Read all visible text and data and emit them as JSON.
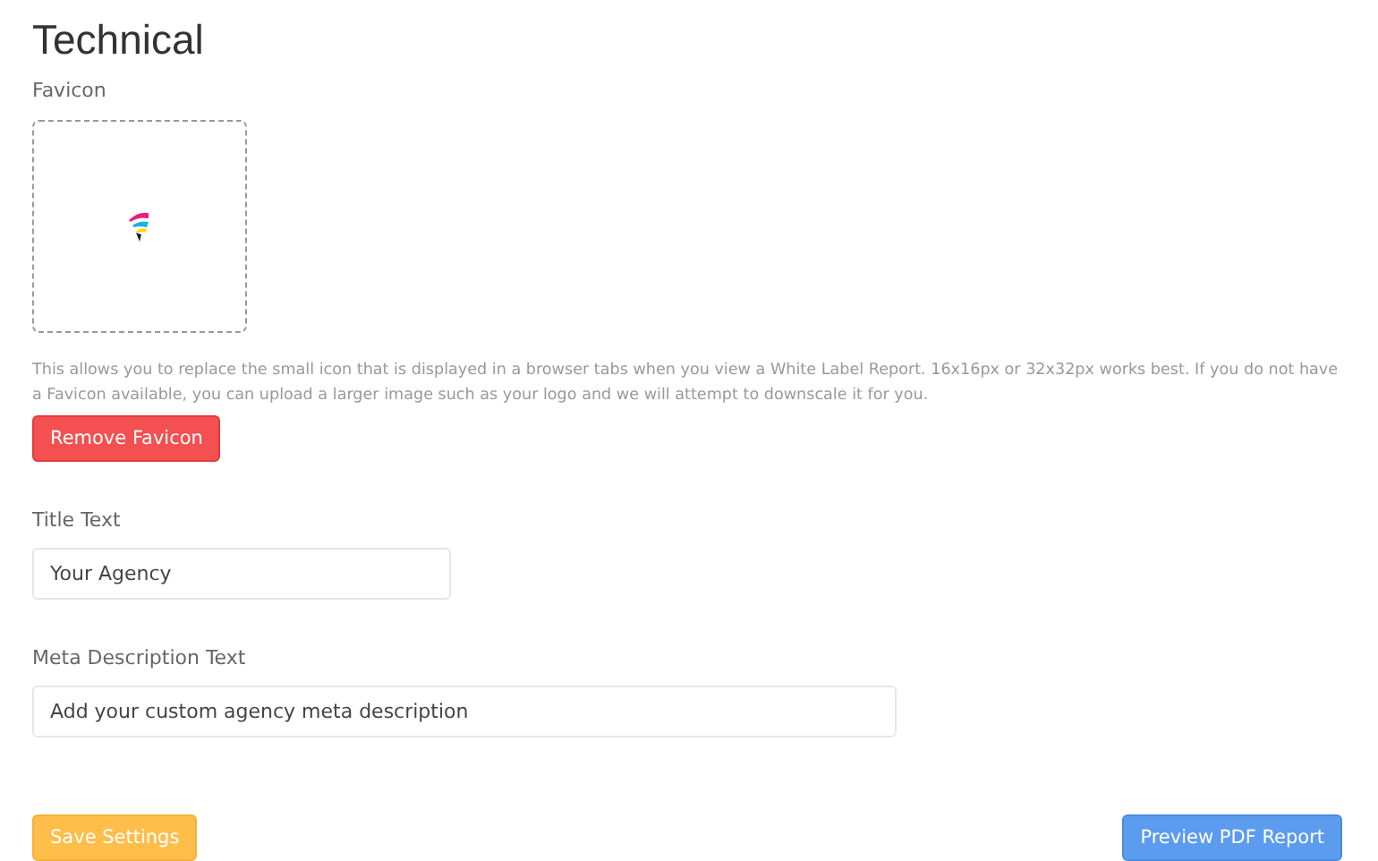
{
  "heading": "Technical",
  "favicon": {
    "label": "Favicon",
    "help": "This allows you to replace the small icon that is displayed in a browser tabs when you view a White Label Report. 16x16px or 32x32px works best. If you do not have a Favicon available, you can upload a larger image such as your logo and we will attempt to downscale it for you.",
    "button": {
      "label": "Remove Favicon",
      "kind": "danger"
    }
  },
  "fields": [
    {
      "label": "Title Text",
      "value": "Your Agency",
      "kind": "short"
    },
    {
      "label": "Meta Description Text",
      "value": "Add your custom agency meta description",
      "kind": "long"
    }
  ],
  "actions": [
    {
      "label": "Save Settings",
      "kind": "warning"
    },
    {
      "label": "Preview PDF Report",
      "kind": "primary"
    }
  ]
}
